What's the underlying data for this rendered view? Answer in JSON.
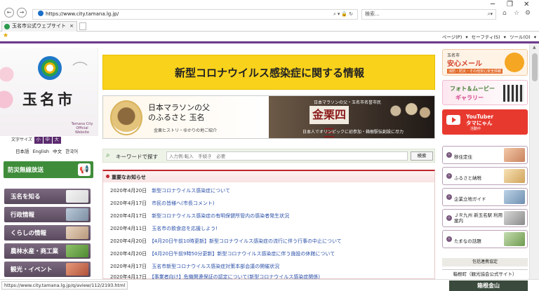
{
  "browser": {
    "url": "https://www.city.tamana.lg.jp/",
    "search_placeholder": "検索...",
    "tab_title": "玉名市公式ウェブサイト",
    "command_items": "ページ(P) ▾  セーフティ(S) ▾  ツール(O) ▾",
    "status_url": "https://www.city.tamana.lg.jp/q/aview/112/2193.html"
  },
  "left": {
    "city_name": "玉名市",
    "city_en": "Tamana City Official Website",
    "font_size_label": "文字サイズ",
    "font_sizes": [
      "小",
      "中",
      "大"
    ],
    "languages": [
      "日本語",
      "English",
      "中文",
      "한국어"
    ],
    "bousai_label": "防災無線放送",
    "menu": [
      "玉名を知る",
      "行政情報",
      "くらしの情報",
      "農林水産・商工業",
      "観光・イベント"
    ]
  },
  "center": {
    "covid_banner": "新型コロナウイルス感染症に関する情報",
    "kanakuri": {
      "heading_line1": "日本マラソンの父",
      "heading_line2": "のふるさと 玉名",
      "sub": "金栗ヒストリ・ゆかりの地ご紹介",
      "right_top": "日本マラソンの父・玉名市名誉市民",
      "name": "金栗四三",
      "right_bottom": "日本人でオリンピックに初参加・箱根駅伝創設に尽力"
    },
    "keyword": {
      "label": "キーワードで探す",
      "placeholder": "入力例:転入　手続き　必要",
      "button": "検索"
    },
    "news_title": "重要なお知らせ",
    "news": [
      {
        "date": "2020年4月20日",
        "title": "新型コロナウイルス感染症について"
      },
      {
        "date": "2020年4月17日",
        "title": "市民の皆様へ(市長コメント)"
      },
      {
        "date": "2020年4月17日",
        "title": "新型コロナウイルス感染症の有明保健所管内の感染者発生状況"
      },
      {
        "date": "2020年4月11日",
        "title": "玉名市の飲食店を応援しよう!"
      },
      {
        "date": "2020年4月20日",
        "title": "【4月20日午前10時更新】新型コロナウイルス感染症の流行に伴う行事の中止について"
      },
      {
        "date": "2020年4月20日",
        "title": "【4月20日午前9時50分更新】新型コロナウイルス感染症に伴う施設の休館について"
      },
      {
        "date": "2020年4月17日",
        "title": "玉名市新型コロナウイルス感染症対策本部会議の開催状況"
      },
      {
        "date": "2020年4月17日",
        "title": "【事業者向け】危機関連保証の認定について(新型コロナウイルス感染症関係)"
      }
    ]
  },
  "right": {
    "anshin_top": "玉名市",
    "anshin_title": "安心メール",
    "anshin_sub": "消防・防災・その他安心安全情報",
    "photo_line1": "フォト＆ムービー",
    "photo_line2": "ギャラリー",
    "youtuber_line1": "YouTuber",
    "youtuber_line2": "タマにゃん",
    "youtuber_sub": "活動中",
    "links": [
      "移住定住",
      "ふるさと納税",
      "企業立地ガイド",
      "ＪＲ九州 新玉名駅 利用案内",
      "たまなの話題"
    ],
    "coop_label": "包括連携協定",
    "coop_item": "箱根町（観光協会公式サイト）",
    "hakone": "箱根金山"
  }
}
